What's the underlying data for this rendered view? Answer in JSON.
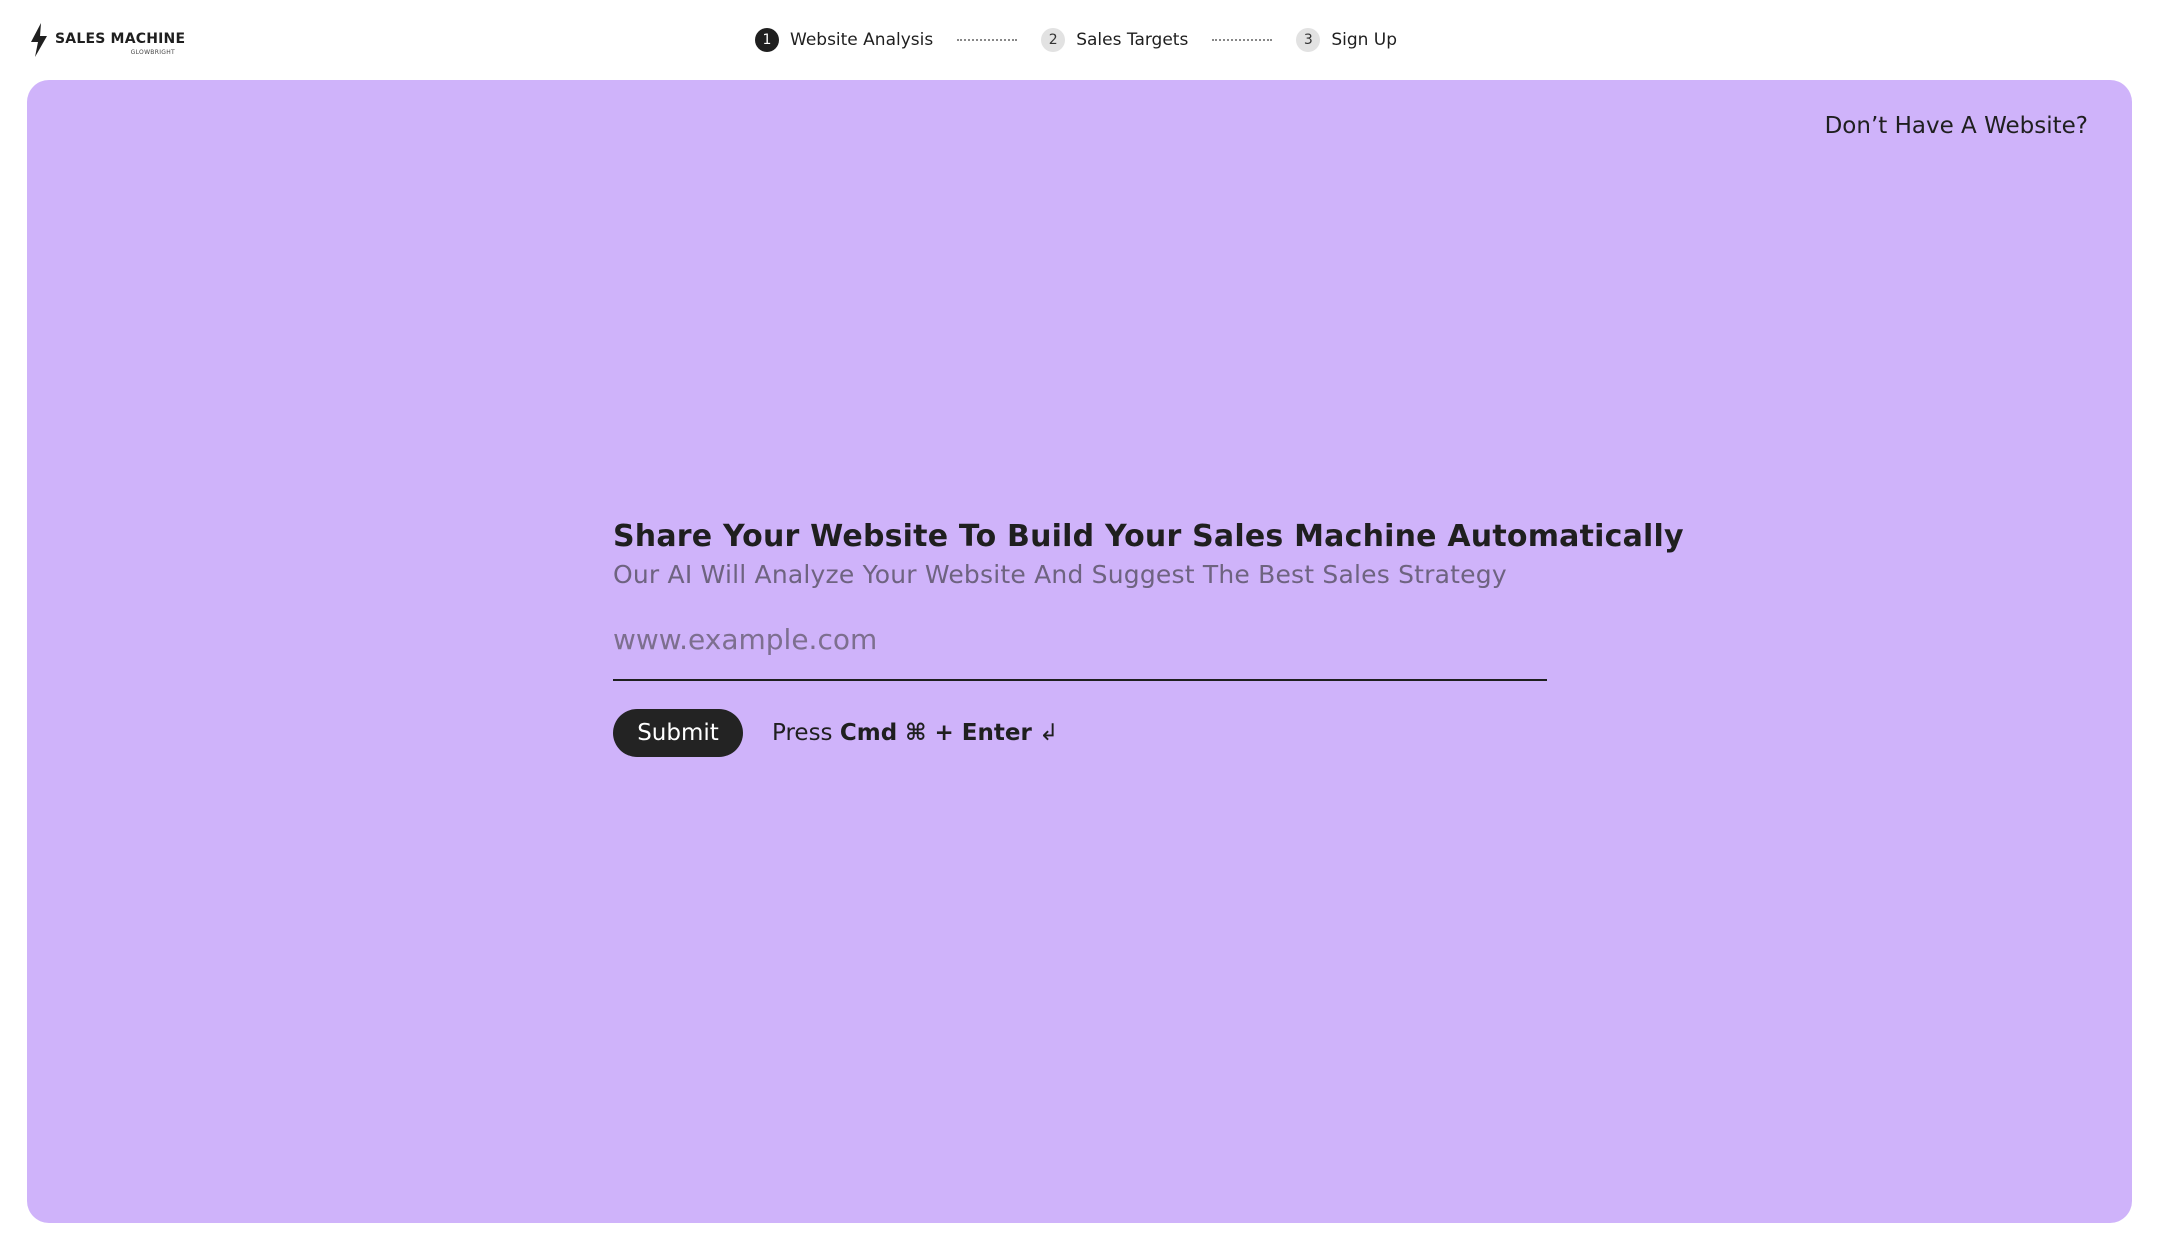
{
  "brand": {
    "name": "SALES MACHINE",
    "sub": "GLOWBRIGHT",
    "icon": "lightning-bolt-icon"
  },
  "steps": [
    {
      "number": "1",
      "label": "Website Analysis",
      "active": true
    },
    {
      "number": "2",
      "label": "Sales Targets",
      "active": false
    },
    {
      "number": "3",
      "label": "Sign Up",
      "active": false
    }
  ],
  "panel": {
    "no_website_link": "Don’t Have A Website?",
    "background": "#cfb3fa"
  },
  "form": {
    "headline_pre": "Share Your Website To ",
    "headline_bold": "Build Your Sales Machine",
    "headline_post": " Automatically",
    "subheadline": "Our AI Will Analyze Your Website And Suggest The Best Sales Strategy",
    "url_placeholder": "www.example.com",
    "url_value": "",
    "submit_label": "Submit",
    "hint_prefix": "Press ",
    "hint_keys": "Cmd ⌘ + Enter",
    "hint_icon": "↲"
  }
}
